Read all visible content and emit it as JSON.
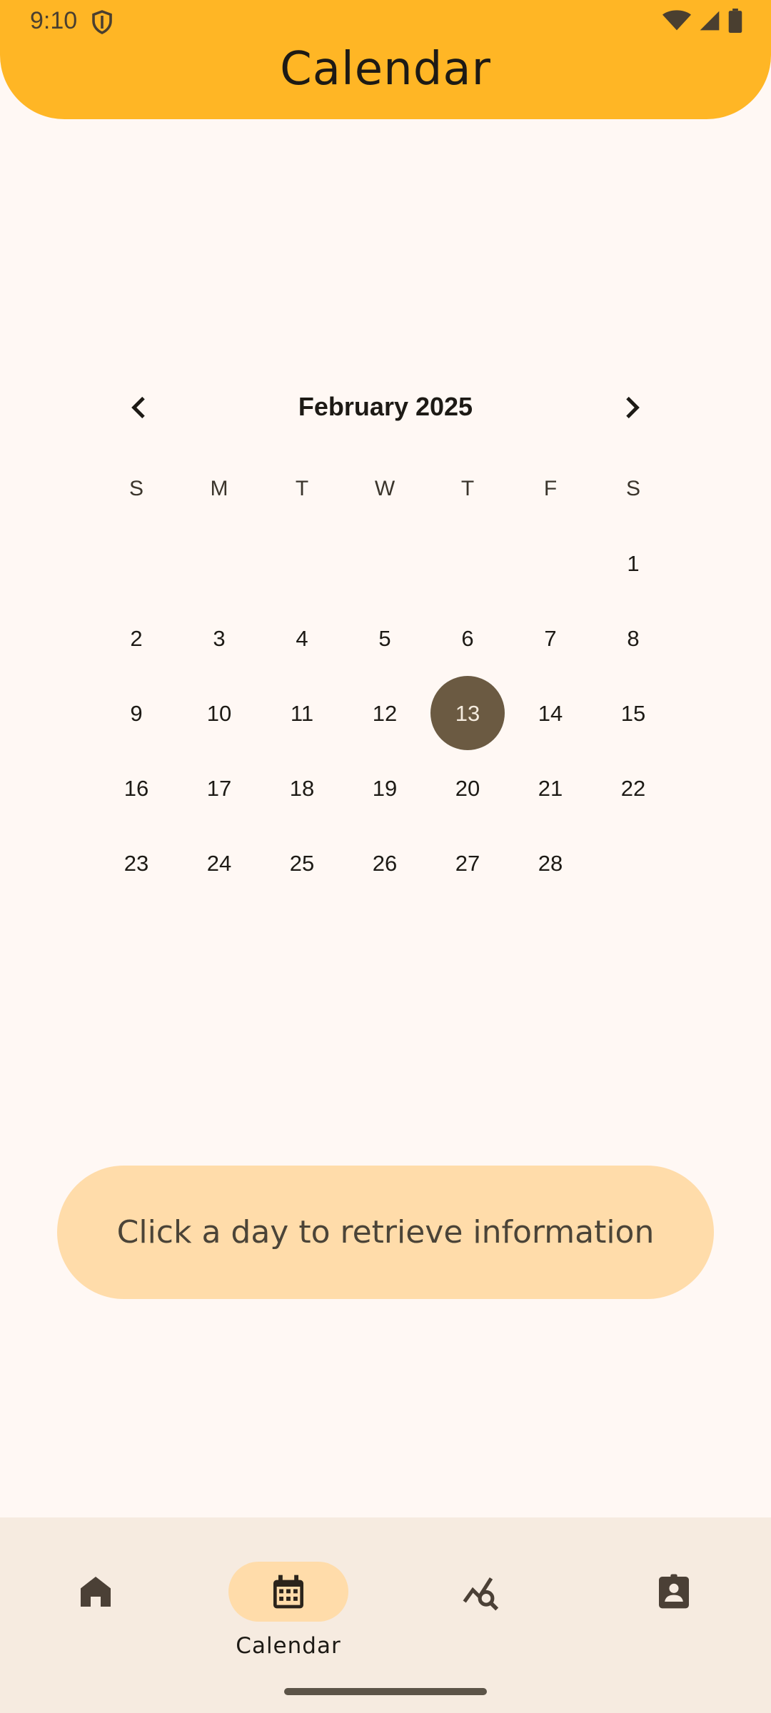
{
  "status_bar": {
    "time": "9:10"
  },
  "header": {
    "title": "Calendar"
  },
  "calendar": {
    "month_label": "February 2025",
    "weekdays": [
      "S",
      "M",
      "T",
      "W",
      "T",
      "F",
      "S"
    ],
    "weeks": [
      [
        "",
        "",
        "",
        "",
        "",
        "",
        "1"
      ],
      [
        "2",
        "3",
        "4",
        "5",
        "6",
        "7",
        "8"
      ],
      [
        "9",
        "10",
        "11",
        "12",
        "13",
        "14",
        "15"
      ],
      [
        "16",
        "17",
        "18",
        "19",
        "20",
        "21",
        "22"
      ],
      [
        "23",
        "24",
        "25",
        "26",
        "27",
        "28",
        ""
      ]
    ],
    "selected_day": "13"
  },
  "info": {
    "message": "Click a day to retrieve information"
  },
  "bottom_nav": {
    "items": [
      {
        "icon": "home-icon",
        "label": ""
      },
      {
        "icon": "calendar-icon",
        "label": "Calendar",
        "active": true
      },
      {
        "icon": "insights-search-icon",
        "label": ""
      },
      {
        "icon": "profile-badge-icon",
        "label": ""
      }
    ]
  },
  "colors": {
    "header_bg": "#ffb625",
    "page_bg": "#fff8f4",
    "selected_day_bg": "#6b5a42",
    "pill_bg": "#ffdcaa",
    "nav_bg": "#f6ebe0"
  }
}
